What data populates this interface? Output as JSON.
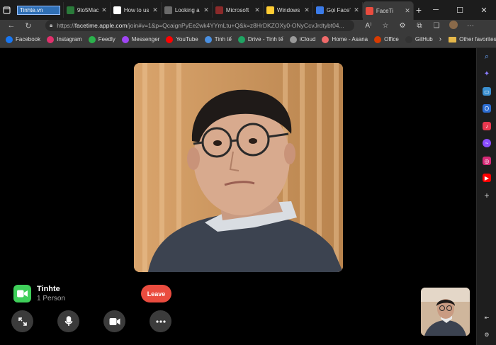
{
  "tabs": [
    {
      "title": "Tinhte.vn",
      "fav_color": "#2f6fb5",
      "fav_glyph": "",
      "active": false
    },
    {
      "title": "9to5Mac",
      "fav_color": "#2a7a3a",
      "fav_glyph": "",
      "active": false
    },
    {
      "title": "How to us",
      "fav_color": "#ffffff",
      "fav_glyph": "",
      "active": false
    },
    {
      "title": "Looking a",
      "fav_color": "#6a6a6a",
      "fav_glyph": "",
      "active": false
    },
    {
      "title": "Microsoft",
      "fav_color": "#8b2a2a",
      "fav_glyph": "",
      "active": false
    },
    {
      "title": "Windows",
      "fav_color": "#ffcc33",
      "fav_glyph": "",
      "active": false
    },
    {
      "title": "Gọi FaceTi",
      "fav_color": "#3b7be8",
      "fav_glyph": "",
      "active": false
    },
    {
      "title": "FaceTi",
      "fav_color": "#ea4c3f",
      "fav_glyph": "",
      "active": true
    }
  ],
  "address": {
    "host": "facetime.apple.com",
    "path": "/join#v=1&p=QcaignPyEe2wk4YYmLtu+Q&k=z8HrDKZOXy0-ONyCcvJrdtybt04...",
    "scheme": "https://"
  },
  "bookmarks": [
    {
      "label": "Facebook",
      "color": "#1877f2"
    },
    {
      "label": "Instagram",
      "color": "#e1306c"
    },
    {
      "label": "Feedly",
      "color": "#2bb24c"
    },
    {
      "label": "Messenger",
      "color": "#a045f5"
    },
    {
      "label": "YouTube",
      "color": "#ff0000"
    },
    {
      "label": "Tinh tế",
      "color": "#4a90e2"
    },
    {
      "label": "Drive - Tinh tế",
      "color": "#1fa463"
    },
    {
      "label": "iCloud",
      "color": "#9a9a9a"
    },
    {
      "label": "Home - Asana",
      "color": "#f06a6a"
    },
    {
      "label": "Office",
      "color": "#d83b01"
    },
    {
      "label": "GitHub",
      "color": "#333333"
    }
  ],
  "bookmarks_more": "Other favorites",
  "call": {
    "name": "Tinhte",
    "participants": "1 Person",
    "leave_label": "Leave"
  },
  "colors": {
    "leave": "#ea4c3f",
    "facetime_green": "#3fcf5a"
  }
}
